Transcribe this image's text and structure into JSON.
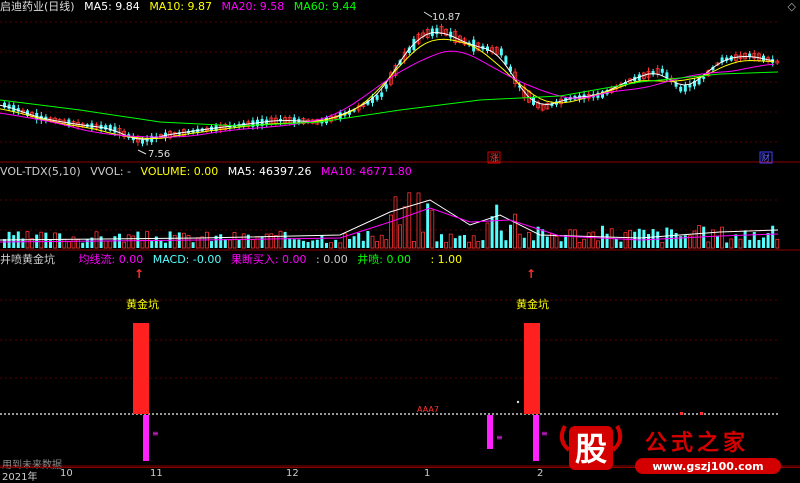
{
  "price_panel": {
    "title": "启迪药业(日线)",
    "ma5_label": "MA5: 9.84",
    "ma10_label": "MA10: 9.87",
    "ma20_label": "MA20: 9.58",
    "ma60_label": "MA60: 9.44",
    "high_mark": "10.87",
    "low_mark": "7.56",
    "event_label_1": "涨",
    "event_label_2": "财"
  },
  "volume_panel": {
    "title": "VOL-TDX(5,10)",
    "vvol": "VVOL: -",
    "volume": "VOLUME: 0.00",
    "ma5": "MA5: 46397.26",
    "ma10": "MA10: 46771.80"
  },
  "indicator_panel": {
    "title": "井喷黄金坑",
    "jxl": "均线流: 0.00",
    "macd": "MACD: -0.00",
    "mcmr": "果断买入: 0.00",
    "blank": ": 0.00",
    "jp": "井喷: 0.00",
    "one": ": 1.00",
    "signal_label_1": "黄金坑",
    "signal_label_2": "黄金坑",
    "small_mark": "AAA7"
  },
  "footer": {
    "note": "用到未来数据",
    "dates": [
      "2021年",
      "10",
      "11",
      "12",
      "1",
      "2"
    ]
  },
  "logo": {
    "glyph": "股",
    "name": "公式之家",
    "url": "www.gszj100.com"
  },
  "colors": {
    "up": "#ff3232",
    "down": "#54fcfc",
    "ma5": "#ffffff",
    "ma10": "#ffff00",
    "ma20": "#ff00ff",
    "ma60": "#00ff00"
  }
}
